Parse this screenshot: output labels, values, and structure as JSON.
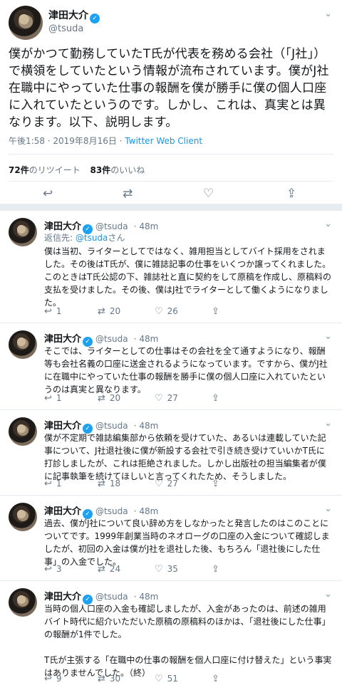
{
  "main_tweet": {
    "author_name": "津田大介",
    "handle": "@tsuda",
    "text": "僕がかつて勤務していたT氏が代表を務める会社（「J社」）で横領をしていたという情報が流布されています。僕がJ社在職中にやっていた仕事の報酬を僕が勝手に僕の個人口座に入れていたというのです。しかし、これは、真実とは異なります。以下、説明します。",
    "timestamp": "午後1:58 · 2019年8月16日 · ",
    "client": "Twitter Web Client",
    "retweets_count": "72件",
    "retweets_label": "のリツイート",
    "likes_count": "83件",
    "likes_label": "のいいね"
  },
  "replies": [
    {
      "author_name": "津田大介",
      "handle": "@tsuda",
      "time": "· 48m",
      "replying_prefix": "返信先: ",
      "replying_to": "@tsuda",
      "replying_suffix": "さん",
      "text": "僕は当初、ライターとしてではなく、雑用担当としてバイト採用をされました。その後はT氏が、僕に雑誌記事の仕事をいくつか譲ってくれました。このときはT氏公認の下、雑誌社と直に契約をして原稿を作成し、原稿料の支払を受けました。その後、僕はJ社でライターとして働くようになりました。",
      "reply_count": "1",
      "retweet_count": "20",
      "like_count": "26"
    },
    {
      "author_name": "津田大介",
      "handle": "@tsuda",
      "time": "· 48m",
      "text": "そこでは、ライターとしての仕事はその会社を全て通すようになり、報酬等も会社名義の口座に送金されるようになっています。ですから、僕がJ社に在職中にやっていた仕事の報酬を勝手に僕の個人口座に入れていたというのは真実と異なります。",
      "reply_count": "1",
      "retweet_count": "20",
      "like_count": "27"
    },
    {
      "author_name": "津田大介",
      "handle": "@tsuda",
      "time": "· 48m",
      "text": "僕が不定期で雑誌編集部から依頼を受けていた、あるいは連載していた記事について、J社退社後に僕が新設する会社で引き続き受けていいかT氏に打診しましたが、これは拒絶されました。しかし出版社の担当編集者が僕に記事執筆を続けてほしいと言ってくれたため、そうしました。",
      "reply_count": "1",
      "retweet_count": "18",
      "like_count": "27"
    },
    {
      "author_name": "津田大介",
      "handle": "@tsuda",
      "time": "· 48m",
      "text": "過去、僕がJ社について良い辞め方をしなかったと発言したのはこのことについてです。1999年創業当時のネオローグの口座の入金について確認しましたが、初回の入金は僕がJ社を退社した後、もちろん「退社後にした仕事」の入金でした。",
      "reply_count": "3",
      "retweet_count": "24",
      "like_count": "35"
    },
    {
      "author_name": "津田大介",
      "handle": "@tsuda",
      "time": "· 48m",
      "text": "当時の個人口座の入金も確認しましたが、入金があったのは、前述の雑用バイト時代に紹介いただいた原稿の原稿料のほかは、「退社後にした仕事」の報酬が1件でした。\n\nT氏が主張する「在職中の仕事の報酬を個人口座に付け替えた」という事実はありませんでした。（終）",
      "reply_count": "9",
      "retweet_count": "30",
      "like_count": "51"
    }
  ],
  "icons": {
    "reply": "↩",
    "retweet": "⇄",
    "like": "♡",
    "share": "⇪",
    "chevron": "⌄",
    "verified": "✓"
  },
  "colors": {
    "link": "#1b95e0",
    "verified": "#1da1f2",
    "muted": "#657786",
    "border": "#e6ecf0"
  }
}
